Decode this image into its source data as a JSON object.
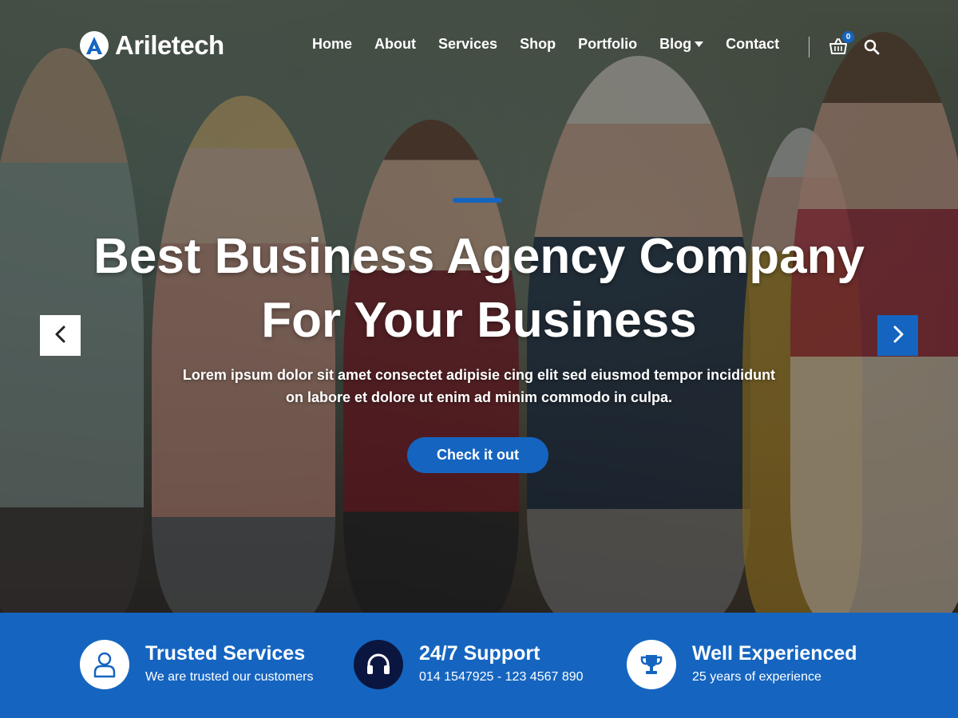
{
  "brand": {
    "name": "Ariletech",
    "logo_letter": "A",
    "accent_color": "#1565c0"
  },
  "nav": {
    "items": [
      {
        "label": "Home"
      },
      {
        "label": "About"
      },
      {
        "label": "Services"
      },
      {
        "label": "Shop"
      },
      {
        "label": "Portfolio"
      },
      {
        "label": "Blog",
        "has_dropdown": true
      },
      {
        "label": "Contact"
      }
    ],
    "cart_count": "0",
    "cart_icon": "shopping-basket-icon",
    "search_icon": "search-icon"
  },
  "hero": {
    "title_line1": "Best Business Agency Company",
    "title_line2": "For Your Business",
    "subtitle_line1": "Lorem ipsum dolor sit amet consectet adipisie cing elit sed eiusmod tempor incididunt",
    "subtitle_line2": "on labore et dolore ut enim ad minim commodo in culpa.",
    "cta_label": "Check it out",
    "prev_icon": "chevron-left-icon",
    "next_icon": "chevron-right-icon"
  },
  "features": [
    {
      "title": "Trusted Services",
      "desc": "We are trusted our customers",
      "icon": "user-icon"
    },
    {
      "title": "24/7 Support",
      "desc": "014 1547925 - 123 4567 890",
      "icon": "headset-icon"
    },
    {
      "title": "Well Experienced",
      "desc": "25 years of experience",
      "icon": "trophy-icon"
    }
  ]
}
